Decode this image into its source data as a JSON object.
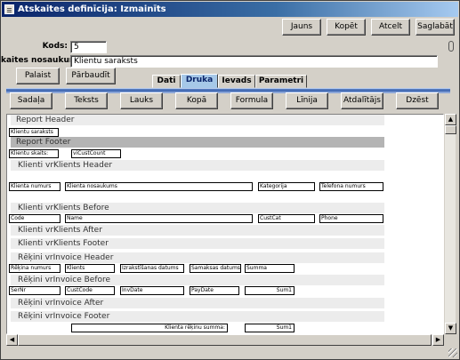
{
  "window": {
    "title": "Atskaites definīcija: Izmainīts"
  },
  "toolbar": {
    "jauns": "Jauns",
    "kopet": "Kopēt",
    "atcelt": "Atcelt",
    "saglabat": "Saglabāt"
  },
  "form": {
    "kods_label": "Kods:",
    "kods_value": "5",
    "nosaukums_label": "kaites nosaukums:",
    "nosaukums_value": "Klientu saraksts"
  },
  "actions": {
    "palaist": "Palaist",
    "parbaudit": "Pārbaudīt"
  },
  "tabs": [
    "Dati",
    "Druka",
    "Ievads",
    "Parametri"
  ],
  "active_tab": "Druka",
  "design_toolbar": [
    "Sadaļa",
    "Teksts",
    "Lauks",
    "Kopā",
    "Formula",
    "Līnija",
    "Atdalītājs",
    "Dzēst"
  ],
  "bands": [
    {
      "label": "Report Header"
    },
    {
      "label": "Report Footer"
    },
    {
      "label": "Klienti vrKlients Header"
    },
    {
      "label": "Klienti vrKlients Before"
    },
    {
      "label": "Klienti vrKlients After"
    },
    {
      "label": "Klienti vrKlients Footer"
    },
    {
      "label": "Rēķini vrInvoice Header"
    },
    {
      "label": "Rēķini vrInvoice Before"
    },
    {
      "label": "Rēķini vrInvoice After"
    },
    {
      "label": "Rēķini vrInvoice Footer"
    }
  ],
  "controls": {
    "report_title": "Klientu saraksts",
    "klientu_skaits": "Klientu skaits:",
    "vicustcount": "viCustCount",
    "h_klienta_numurs": "Klienta numurs",
    "h_klienta_nosaukums": "Klienta nosaukums",
    "h_kategorija": "Kategorija",
    "h_telefona_numurs": "Telefona numurs",
    "f_code": "Code",
    "f_name": "Name",
    "f_custcat": "CustCat",
    "f_phone": "Phone",
    "h_rekina_numurs": "Rēķina numurs",
    "h_klients": "Klients",
    "h_izrakstisanas": "Izrakstīšanas datums",
    "h_samaksas": "Samaksas datums",
    "h_summa": "Summa",
    "f_sernr": "SerNr",
    "f_custcode": "CustCode",
    "f_invdate": "InvDate",
    "f_paydate": "PayDate",
    "f_sum1": "Sum1",
    "klienta_rekinu_summa": "Klienta rēķinu summa:",
    "footer_sum1": "Sum1"
  },
  "colors": {
    "title_bar": "#0a246a",
    "active_tab": "#a6c8e8",
    "selected_band": "#b4b4b4"
  },
  "icons": [
    "app-icon",
    "paperclip-icon",
    "scroll-up-icon",
    "scroll-down-icon",
    "scroll-left-icon",
    "scroll-right-icon",
    "resize-grip-icon"
  ]
}
